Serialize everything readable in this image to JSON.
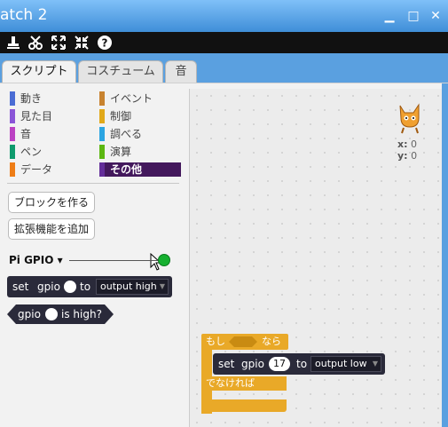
{
  "window": {
    "title": "atch 2",
    "help_icon": "help-icon"
  },
  "toolbar": {
    "icons": [
      "stamp-icon",
      "cut-icon",
      "grow-icon",
      "shrink-icon",
      "help-icon"
    ]
  },
  "tabs": [
    {
      "label": "スクリプト",
      "active": true
    },
    {
      "label": "コスチューム",
      "active": false
    },
    {
      "label": "音",
      "active": false
    }
  ],
  "categories": [
    {
      "label": "動き",
      "color": "#4a6cd4"
    },
    {
      "label": "見た目",
      "color": "#8a55d7"
    },
    {
      "label": "音",
      "color": "#bb42c3"
    },
    {
      "label": "ペン",
      "color": "#0e9a6c"
    },
    {
      "label": "データ",
      "color": "#ee7d16"
    },
    {
      "label": "イベント",
      "color": "#c88330"
    },
    {
      "label": "制御",
      "color": "#e1a91a"
    },
    {
      "label": "調べる",
      "color": "#2ca5e2"
    },
    {
      "label": "演算",
      "color": "#5cb712"
    },
    {
      "label": "その他",
      "color": "#632d99",
      "selected": true
    }
  ],
  "buttons": {
    "make_block": "ブロックを作る",
    "add_extension": "拡張機能を追加"
  },
  "extension": {
    "title": "Pi GPIO",
    "status_color": "#16b030"
  },
  "palette_blocks": {
    "set_gpio": {
      "set": "set",
      "gpio": "gpio",
      "to": "to",
      "option": "output high"
    },
    "gpio_high": {
      "gpio": "gpio",
      "is_high": "is high?"
    }
  },
  "stage": {
    "x_label": "x:",
    "x_value": "0",
    "y_label": "y:",
    "y_value": "0"
  },
  "script": {
    "if_label": "もし",
    "then_label": "なら",
    "else_label": "でなければ",
    "inner": {
      "set": "set",
      "gpio": "gpio",
      "pin": "17",
      "to": "to",
      "option": "output low"
    }
  }
}
